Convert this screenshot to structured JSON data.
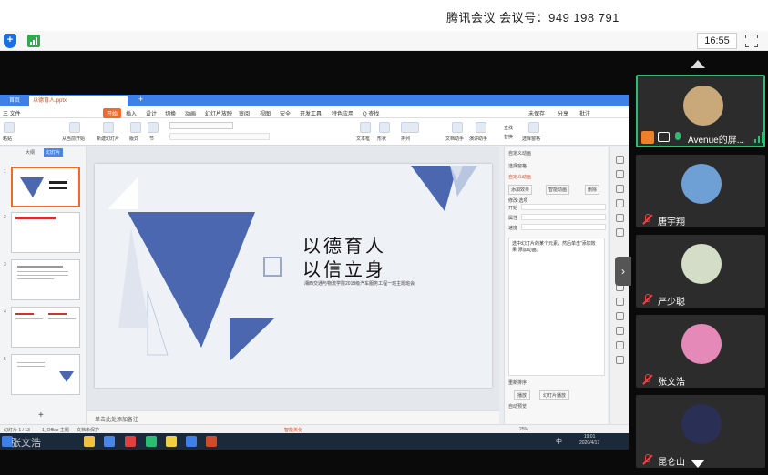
{
  "meeting": {
    "title": "腾讯会议 会议号：949 198 791",
    "time": "16:55",
    "shield_icon": "shield-icon",
    "signal_icon": "signal-icon",
    "fullscreen_icon": "fullscreen-icon"
  },
  "wps": {
    "tabs": [
      "首页",
      "以德育人.pptx"
    ],
    "menu": [
      "三 文件",
      "开始",
      "插入",
      "设计",
      "切换",
      "动画",
      "幻灯片放映",
      "审阅",
      "视图",
      "安全",
      "开发工具",
      "特色应用",
      "Q 查找"
    ],
    "menu_right": [
      "未保存",
      "分享",
      "批注"
    ],
    "ribbon": [
      "粘贴",
      "从当前开始",
      "新建幻灯片",
      "版式",
      "节",
      "文本框",
      "形状",
      "排列",
      "文档助手",
      "演讲助手",
      "查找",
      "替换",
      "选择窗格"
    ],
    "thumb_tabs": [
      "大纲",
      "幻灯片"
    ],
    "thumb_numbers": [
      "1",
      "2",
      "3",
      "4",
      "5"
    ],
    "slide": {
      "title_line1": "以德育人",
      "title_line2": "以信立身",
      "subtitle": "湘西交通与物流学院2018级汽车服务工程一班主题班会"
    },
    "notes": "单击此处添加备注",
    "pane": {
      "title": "自定义动画",
      "select_pane": "选择窗格",
      "custom_animation": "自定义动画",
      "add_effect": "添加效果",
      "smart_animation": "智能动画",
      "delete": "删除",
      "modify": "修改:选项",
      "start": "开始",
      "property": "属性",
      "speed": "速度",
      "tip": "选中幻灯片的某个元素，然后单击“添加效果”添加动画。",
      "reorder": "重新排序",
      "play": "播放",
      "slideshow": "幻灯片播放",
      "autopreview": "自动预览"
    },
    "status": {
      "slide_count": "幻灯片 1 / 13",
      "theme": "1_Office 主题",
      "protect": "文档未保护",
      "beautify": "智能美化",
      "zoom": "25%"
    }
  },
  "taskbar": {
    "user_label": "张文浩",
    "clock_time": "19:01",
    "clock_date": "2020/4/17",
    "lang": "中"
  },
  "participants": [
    {
      "name": "Avenue的屏...",
      "mic": "on",
      "avatar_color": "#c9a97a"
    },
    {
      "name": "唐宇翔",
      "mic": "muted",
      "avatar_color": "#6ea0d6"
    },
    {
      "name": "严少聪",
      "mic": "muted",
      "avatar_color": "#d4ddc8"
    },
    {
      "name": "张文浩",
      "mic": "muted",
      "avatar_color": "#e58ab8"
    },
    {
      "name": "昆仑山",
      "mic": "muted",
      "avatar_color": "#2a2f55"
    }
  ],
  "colors": {
    "wps_blue": "#3f7fe8",
    "slide_triangle": "#4a67b0",
    "active_green": "#2bbd73",
    "muted_red": "#ee4444"
  }
}
